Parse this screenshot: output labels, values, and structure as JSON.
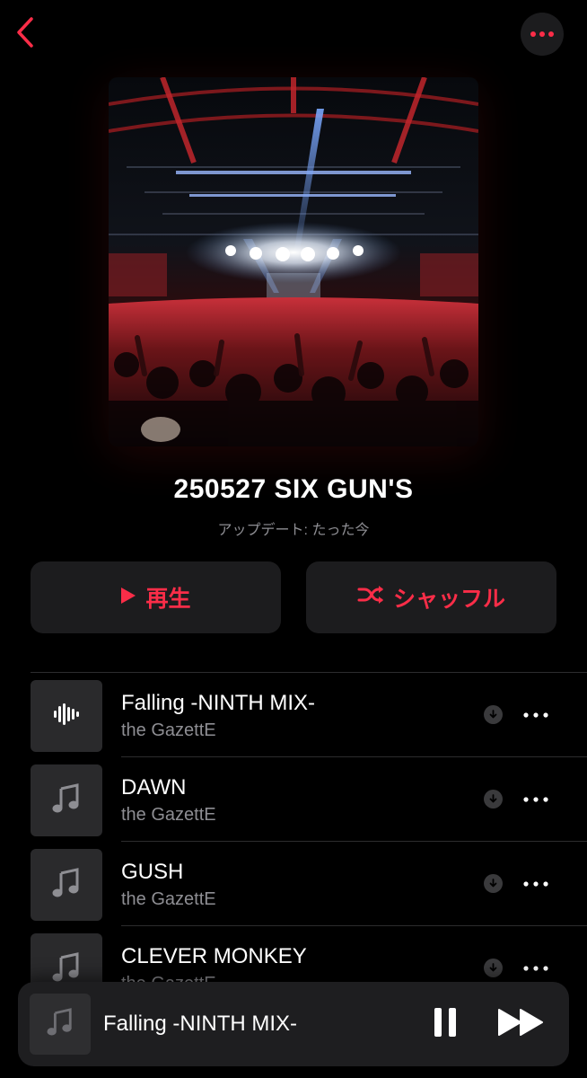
{
  "colors": {
    "accent": "#fa2d48",
    "background": "#000000",
    "secondary_text": "#8e8e93",
    "button_bg": "#1c1c1e"
  },
  "nav": {
    "back_icon": "chevron-left-icon",
    "more_icon": "ellipsis-icon"
  },
  "playlist": {
    "title": "250527 SIX GUN'S",
    "updated": "アップデート: たった今",
    "artwork": "concert-crowd-photo"
  },
  "actions": {
    "play_label": "再生",
    "shuffle_label": "シャッフル"
  },
  "tracks": [
    {
      "title": "Falling -NINTH MIX-",
      "artist": "the GazettE",
      "playing": true
    },
    {
      "title": "DAWN",
      "artist": "the GazettE",
      "playing": false
    },
    {
      "title": "GUSH",
      "artist": "the GazettE",
      "playing": false
    },
    {
      "title": "CLEVER MONKEY",
      "artist": "the GazettE",
      "playing": false
    }
  ],
  "mini_player": {
    "title": "Falling -NINTH MIX-",
    "state": "playing"
  }
}
